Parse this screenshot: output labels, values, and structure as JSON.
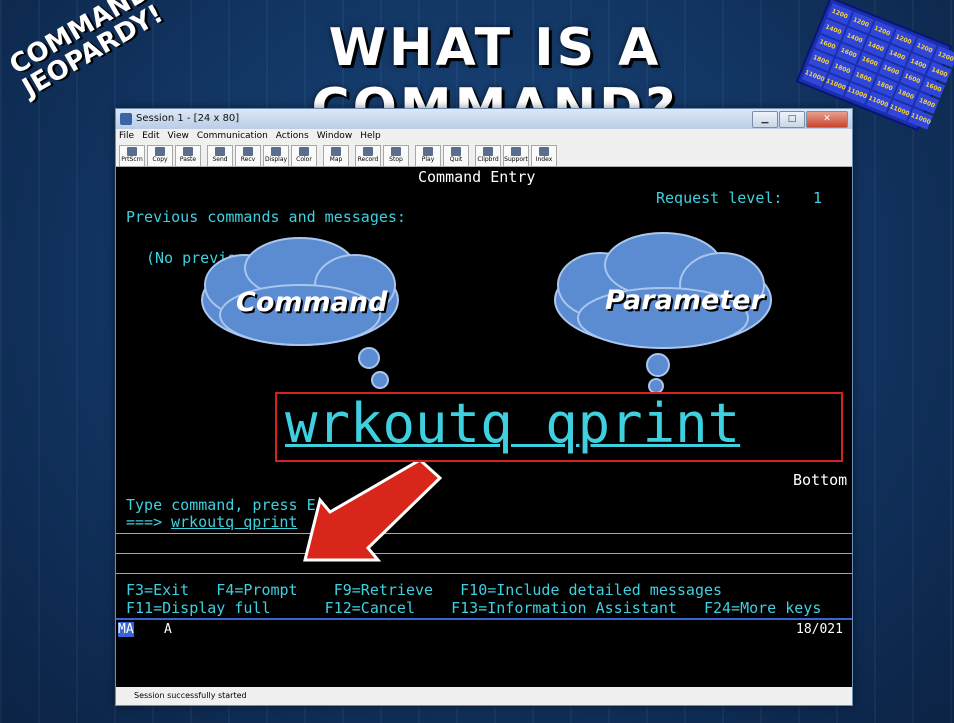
{
  "slide": {
    "title": "WHAT IS A COMMAND?",
    "logo": [
      "COMMAND",
      "JEOPARDY!"
    ],
    "board_values": [
      "1200",
      "1200",
      "1200",
      "1200",
      "1200",
      "1200",
      "1400",
      "1400",
      "1400",
      "1400",
      "1400",
      "1400",
      "1600",
      "1600",
      "1600",
      "1600",
      "1600",
      "1600",
      "1800",
      "1800",
      "1800",
      "1800",
      "1800",
      "1800",
      "11000",
      "11000",
      "11000",
      "11000",
      "11000",
      "11000"
    ]
  },
  "window": {
    "title": "Session 1 - [24 x 80]",
    "menu": [
      "File",
      "Edit",
      "View",
      "Communication",
      "Actions",
      "Window",
      "Help"
    ],
    "toolbar": [
      "PrtScrn",
      "Copy",
      "Paste",
      "Send",
      "Recv",
      "Display",
      "Color",
      "Map",
      "Record",
      "Stop",
      "Play",
      "Quit",
      "Clipbrd",
      "Support",
      "Index"
    ],
    "status": "Session successfully started"
  },
  "terminal": {
    "header": "Command Entry",
    "request_level_label": "Request level:",
    "request_level": "1",
    "prev_label": "Previous commands and messages:",
    "no_prev": "(No previo",
    "bottom": "Bottom",
    "type_prompt": "Type command, press E",
    "arrow_prefix": "===>",
    "command_input": "wrkoutq qprint",
    "fkeys_row1": "F3=Exit   F4=Prompt    F9=Retrieve   F10=Include detailed messages",
    "fkeys_row2": "F11=Display full      F12=Cancel    F13=Information Assistant   F24=More keys",
    "oia_left": "MA",
    "oia_a": "A",
    "oia_pos": "18/021"
  },
  "annotations": {
    "command_label": "Command",
    "parameter_label": "Parameter",
    "big_command": "wrkoutq qprint"
  },
  "colors": {
    "terminal_text": "#3fd0e0",
    "highlight_box": "#d62020",
    "cloud": "#5b8bd0",
    "arrow": "#d8261a"
  }
}
